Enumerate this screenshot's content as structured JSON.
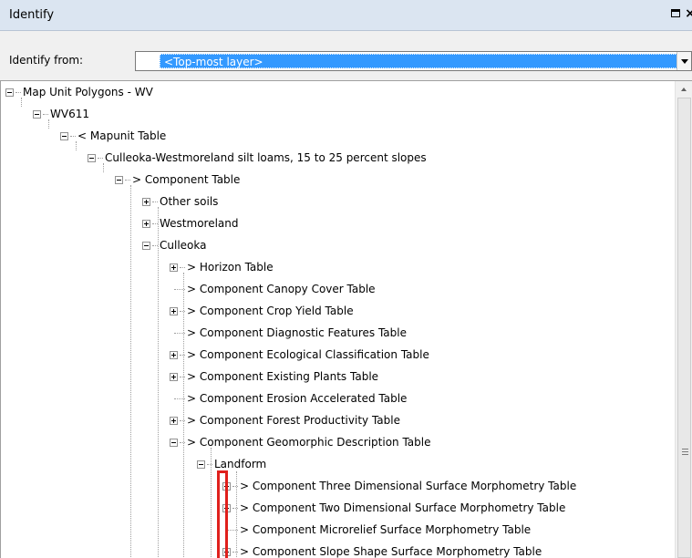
{
  "window": {
    "title": "Identify",
    "maximize_glyph": "□",
    "close_glyph": "×"
  },
  "identify": {
    "label": "Identify from:",
    "selected": "<Top-most layer>"
  },
  "tree": {
    "nodes": [
      "Map Unit Polygons - WV",
      "WV611",
      "< Mapunit Table",
      "Culleoka-Westmoreland silt loams, 15 to 25 percent slopes",
      "> Component Table",
      "Other soils",
      "Westmoreland",
      "Culleoka",
      "> Horizon Table",
      "> Component Canopy Cover Table",
      "> Component Crop Yield Table",
      "> Component Diagnostic Features Table",
      "> Component Ecological Classification Table",
      "> Component Existing Plants Table",
      "> Component Erosion Accelerated Table",
      "> Component Forest Productivity Table",
      "> Component Geomorphic Description Table",
      "Landform",
      "> Component Three Dimensional Surface Morphometry Table",
      "> Component Two Dimensional Surface Morphometry Table",
      "> Component Microrelief Surface Morphometry Table",
      "> Component Slope Shape Surface Morphometry Table"
    ]
  },
  "colors": {
    "selection": "#3399ff",
    "highlight_box": "#e0201c"
  }
}
